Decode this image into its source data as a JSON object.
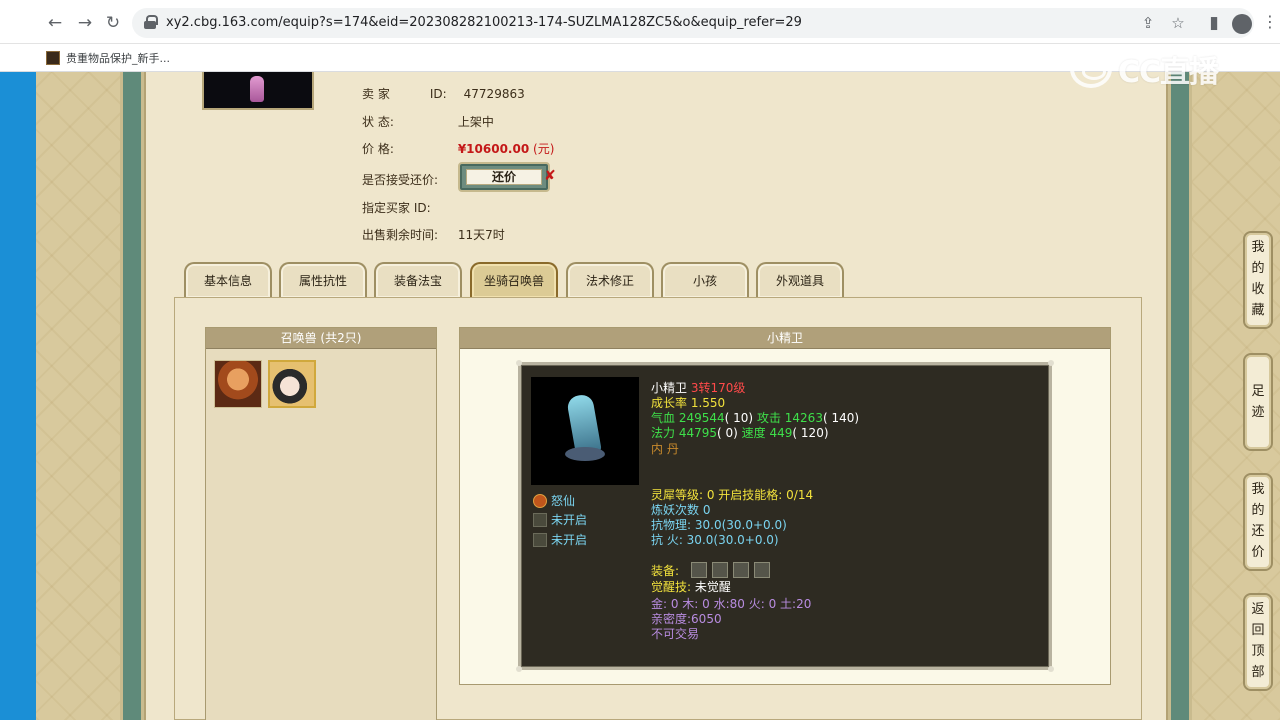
{
  "browser": {
    "url": "xy2.cbg.163.com/equip?s=174&eid=202308282100213-174-SUZLMA128ZC5&o&equip_refer=29",
    "back_icon": "←",
    "forward_icon": "→",
    "reload_icon": "↻",
    "share_icon": "⇪",
    "star_icon": "☆",
    "sidebar_icon": "▮",
    "menu_icon": "⋮",
    "bookmark": "贵重物品保护_新手..."
  },
  "watermark": "CC直播",
  "seller": {
    "label_seller": "卖 家",
    "id_label": "ID:",
    "id_value": "47729863",
    "label_status": "状 态:",
    "status_value": "上架中",
    "label_price": "价 格:",
    "price_value": "¥10600.00",
    "price_unit": "(元)",
    "label_counter": "是否接受还价:",
    "counter_button": "还价",
    "counter_x": "✘",
    "label_buyer": "指定买家 ID:",
    "label_remaining": "出售剩余时间:",
    "remaining_value": "11天7时"
  },
  "tabs": [
    "基本信息",
    "属性抗性",
    "装备法宝",
    "坐骑召唤兽",
    "法术修正",
    "小孩",
    "外观道具"
  ],
  "active_tab": "坐骑召唤兽",
  "pets": {
    "header": "召唤兽 (共2只)",
    "count": 2
  },
  "detail": {
    "header": "小精卫",
    "name": "小精卫",
    "level": "3转170级",
    "growth": "成长率 1.550",
    "hp_label": "气血",
    "hp": "249544",
    "hp_extra": "( 10)",
    "atk_label": "攻击",
    "atk": "14263",
    "atk_extra": "( 140)",
    "mp_label": "法力",
    "mp": "44795",
    "mp_extra": "( 0)",
    "spd_label": "速度",
    "spd": "449",
    "spd_extra": "( 120)",
    "neidan": "内 丹",
    "skills": [
      "怒仙",
      "未开启",
      "未开启"
    ],
    "lingxi": "灵犀等级: 0 开启技能格: 0/14",
    "lianyao": "炼妖次数 0",
    "kangwuli": "抗物理: 30.0(30.0+0.0)",
    "kanghuo": "抗  火: 30.0(30.0+0.0)",
    "equip_label": "装备:",
    "juexing_label": "觉醒技:",
    "juexing_value": "未觉醒",
    "elements": "金: 0 木: 0 水:80 火: 0 土:20",
    "intimacy": "亲密度:6050",
    "tradable": "不可交易"
  },
  "side_buttons": [
    {
      "name": "favorites",
      "label": "我的收藏",
      "chars": [
        "我",
        "的",
        "收",
        "藏"
      ]
    },
    {
      "name": "footprints",
      "label": "足迹",
      "chars": [
        "足",
        "迹"
      ]
    },
    {
      "name": "my-offers",
      "label": "我的还价",
      "chars": [
        "我",
        "的",
        "还",
        "价"
      ]
    },
    {
      "name": "back-to-top",
      "label": "返回顶部",
      "chars": [
        "返",
        "回",
        "顶",
        "部"
      ]
    }
  ],
  "colors": {
    "page_bg": "#d8c99d",
    "content_bg": "#efe6cc",
    "frame": "#5f8a7a",
    "price_red": "#c41818",
    "card_bg": "#2e2b22",
    "text_green": "#3ee04a",
    "text_yellow": "#f2e23c"
  }
}
